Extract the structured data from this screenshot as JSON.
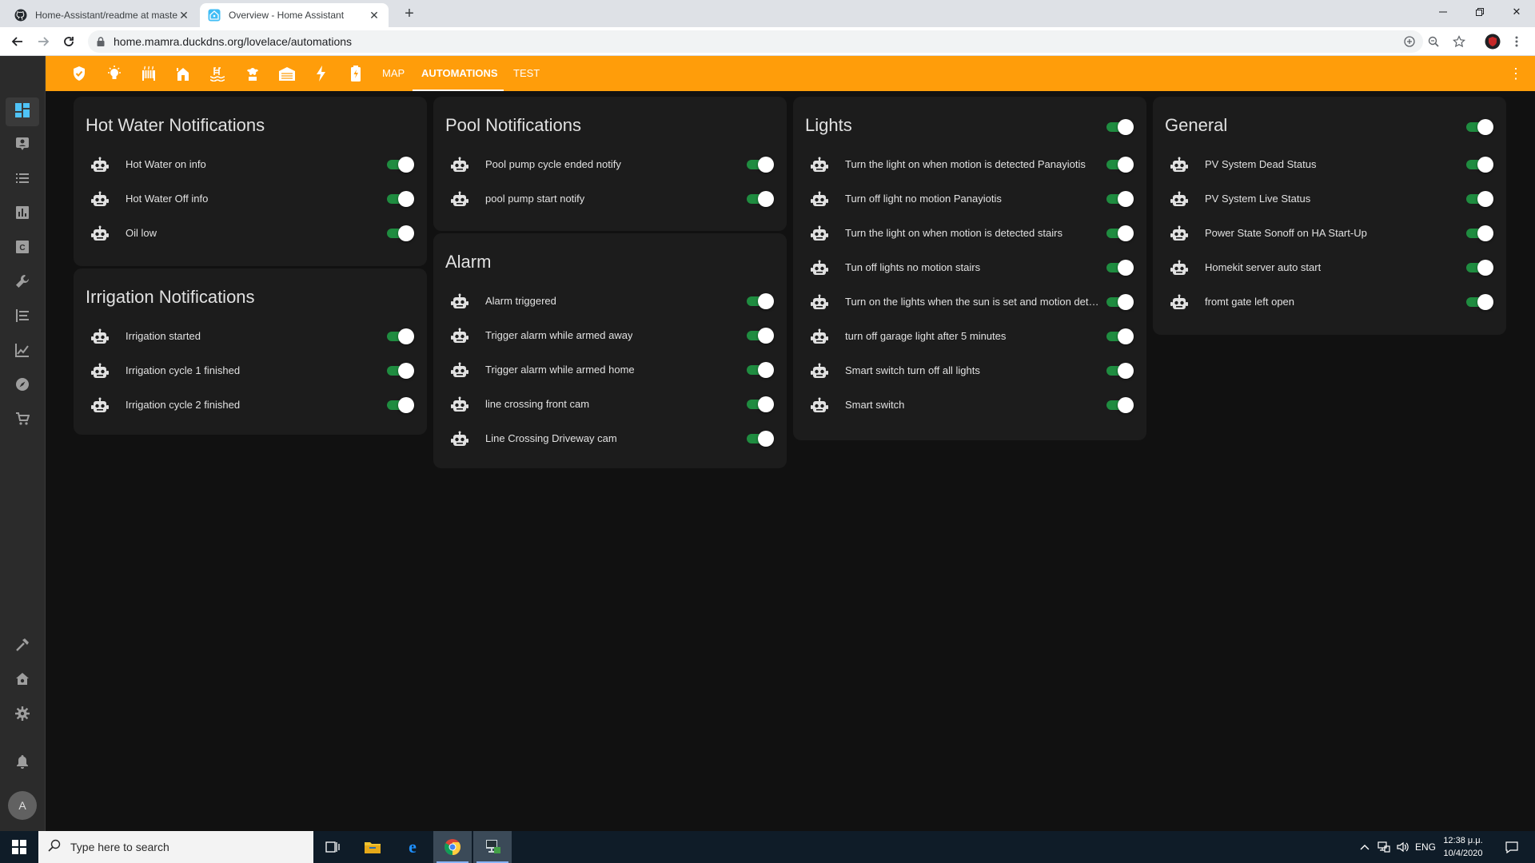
{
  "browser": {
    "tabs": [
      {
        "title": "Home-Assistant/readme at master",
        "icon": "github-icon"
      },
      {
        "title": "Overview - Home Assistant",
        "icon": "home-assistant-icon"
      }
    ],
    "url": "home.mamra.duckdns.org/lovelace/automations"
  },
  "toolbar": {
    "icons": [
      "shield-icon",
      "lightbulb-icon",
      "radiator-icon",
      "garden-icon",
      "pool-icon",
      "sprinkler-icon",
      "garage-icon",
      "flash-icon",
      "battery-icon"
    ],
    "tabs": [
      {
        "label": "MAP",
        "active": false
      },
      {
        "label": "AUTOMATIONS",
        "active": true
      },
      {
        "label": "TEST",
        "active": false
      }
    ],
    "accent_color": "#ff9d0a"
  },
  "cards": [
    {
      "title": "Hot Water Notifications",
      "items": [
        "Hot Water on info",
        "Hot Water Off info",
        "Oil low"
      ]
    },
    {
      "title": "Irrigation Notifications",
      "items": [
        "Irrigation started",
        "Irrigation cycle 1 finished",
        "Irrigation cycle 2 finished"
      ]
    },
    {
      "title": "Pool Notifications",
      "items": [
        "Pool pump cycle ended notify",
        "pool pump start notify"
      ]
    },
    {
      "title": "Alarm",
      "items": [
        "Alarm triggered",
        "Trigger alarm while armed away",
        "Trigger alarm while armed home",
        "line crossing front cam",
        "Line Crossing Driveway cam"
      ]
    },
    {
      "title": "Lights",
      "header_toggle": true,
      "items": [
        "Turn the light on when motion is detected Panayiotis",
        "Turn off light no motion Panayiotis",
        "Turn the light on when motion is detected stairs",
        "Tun off lights no motion stairs",
        "Turn on the lights when the sun is set and motion detected",
        "turn off garage light after 5 minutes",
        "Smart switch turn off all lights",
        "Smart switch"
      ]
    },
    {
      "title": "General",
      "header_toggle": true,
      "items": [
        "PV System Dead Status",
        "PV System Live Status",
        "Power State Sonoff on HA Start-Up",
        "Homekit server auto start",
        "fromt gate left open"
      ]
    }
  ],
  "sidebar": {
    "avatar_letter": "A"
  },
  "taskbar": {
    "search_placeholder": "Type here to search",
    "language": "ENG",
    "time": "12:38 μ.μ.",
    "date": "10/4/2020"
  },
  "toggle_color": "#1f8c40"
}
